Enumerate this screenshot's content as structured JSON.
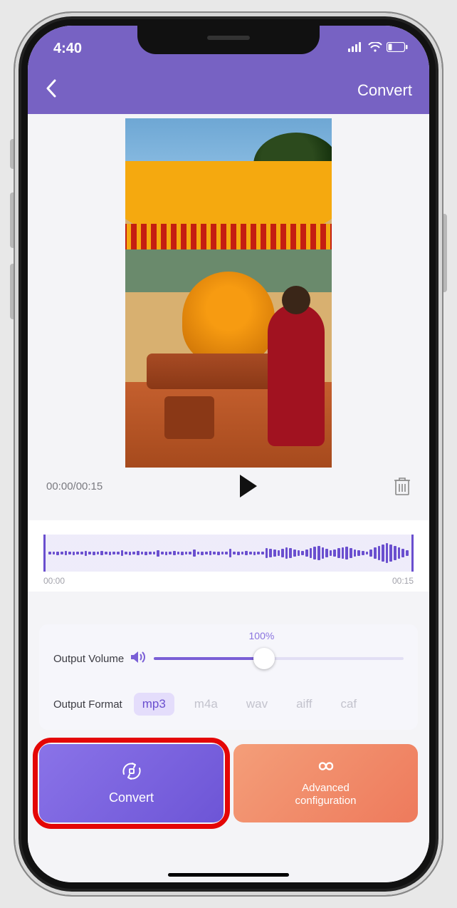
{
  "status": {
    "time": "4:40"
  },
  "header": {
    "title": "Convert"
  },
  "video": {
    "time_current": "00:00",
    "time_total": "00:15",
    "time_display": "00:00/00:15"
  },
  "waveform": {
    "start": "00:00",
    "end": "00:15"
  },
  "settings": {
    "volume_label": "Output Volume",
    "volume_percent": "100%",
    "format_label": "Output Format",
    "formats": {
      "mp3": "mp3",
      "m4a": "m4a",
      "wav": "wav",
      "aiff": "aiff",
      "caf": "caf"
    },
    "selected_format": "mp3"
  },
  "actions": {
    "convert": "Convert",
    "advanced": "Advanced\nconfiguration"
  }
}
